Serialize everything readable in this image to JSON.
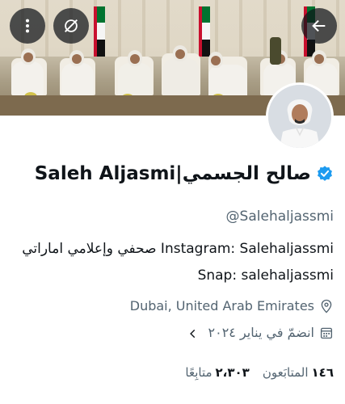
{
  "profile": {
    "display_name": "Saleh Aljasmi|صالح الجسمي",
    "handle": "@Salehaljassmi",
    "bio_line1": "صحفي وإعلامي اماراتي  Instagram: Salehaljassmi",
    "bio_line2": "Snap: salehaljassmi",
    "location": "Dubai, United Arab Emirates",
    "joined": "انضمّ في يناير ٢٠٢٤",
    "following_count": "١٤٦",
    "following_label": "المتابَعون",
    "followers_count": "٢،٣٠٣",
    "followers_label": "متابِعًا"
  },
  "icons": {
    "back": "arrow-left-icon",
    "more": "more-vertical-icon",
    "mute": "mute-icon",
    "verified": "verified-badge-icon",
    "location": "location-pin-icon",
    "calendar": "calendar-icon",
    "chevron": "chevron-left-icon"
  },
  "colors": {
    "accent": "#1d9bf0",
    "text_primary": "#0f1419",
    "text_secondary": "#536471",
    "button_overlay": "rgba(15,20,25,0.72)"
  }
}
